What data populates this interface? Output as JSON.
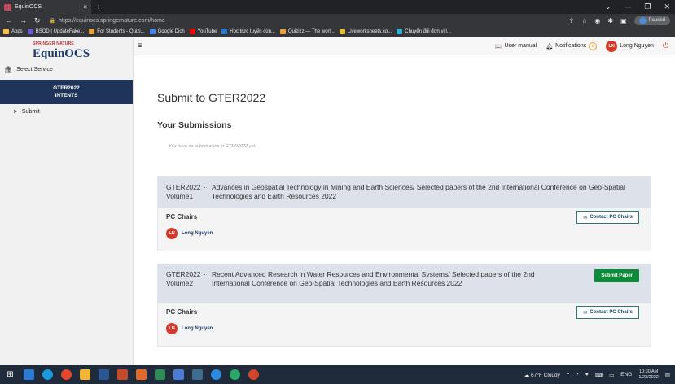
{
  "browser": {
    "tab_title": "EquinOCS",
    "tab_close": "×",
    "new_tab": "+",
    "url": "https://equinocs.springernature.com/home",
    "profile_status": "Paused",
    "bookmarks": [
      {
        "label": "Apps",
        "color": "#f6c343"
      },
      {
        "label": "BSOD | UpdateFake...",
        "color": "#6a5acd"
      },
      {
        "label": "For Students - Quizi...",
        "color": "#e9a23b"
      },
      {
        "label": "Google Dịch",
        "color": "#4285f4"
      },
      {
        "label": "YouTube",
        "color": "#ff0000"
      },
      {
        "label": "Học trực tuyến cùn...",
        "color": "#2b7bd6"
      },
      {
        "label": "Quizizz — The worl...",
        "color": "#e9a23b"
      },
      {
        "label": "Liveworksheets.co...",
        "color": "#e6c02a"
      },
      {
        "label": "Chuyển đổi đơn vị l...",
        "color": "#2bb0d6"
      }
    ]
  },
  "sidebar": {
    "logo_top": "SPRINGER NATURE",
    "logo_main": "EquinOCS",
    "select_service": "Select Service",
    "conference_line1": "GTER2022",
    "conference_line2": "INTENTS",
    "submit": "Submit"
  },
  "topnav": {
    "user_manual": "User manual",
    "notifications": "Notifications",
    "notifications_count": "0",
    "user_initials": "LN",
    "user_name": "Long Nguyen"
  },
  "main": {
    "page_title": "Submit to GTER2022",
    "section_title": "Your Submissions",
    "empty_note": "You have no submissions in GTER2022 yet.",
    "volumes": [
      {
        "code": "GTER2022 Volume1",
        "separator": "·",
        "title": "Advances in Geospatial Technology in Mining and Earth Sciences/ Selected papers of the 2nd International Conference on Geo-Spatial Technologies and Earth Resources 2022",
        "pc_label": "PC Chairs",
        "chair_initials": "LN",
        "chair_name": "Long Nguyen",
        "contact_label": "Contact PC Chairs"
      },
      {
        "code": "GTER2022 Volume2",
        "separator": "·",
        "title": "Recent Advanced Research in Water Resources and Environmental Systems/ Selected papers of the 2nd International Conference on Geo-Spatial Technologies and Earth Resources 2022",
        "pc_label": "PC Chairs",
        "chair_initials": "LN",
        "chair_name": "Long Nguyen",
        "contact_label": "Contact PC Chairs",
        "submit_label": "Submit Paper"
      }
    ]
  },
  "taskbar": {
    "weather": "67°F Cloudy",
    "language": "ENG",
    "time": "10:30 AM",
    "date": "1/23/2022"
  },
  "colors": {
    "brand_navy": "#1e3458",
    "submit_green": "#0e8a3a",
    "avatar_red": "#d23a2c"
  }
}
